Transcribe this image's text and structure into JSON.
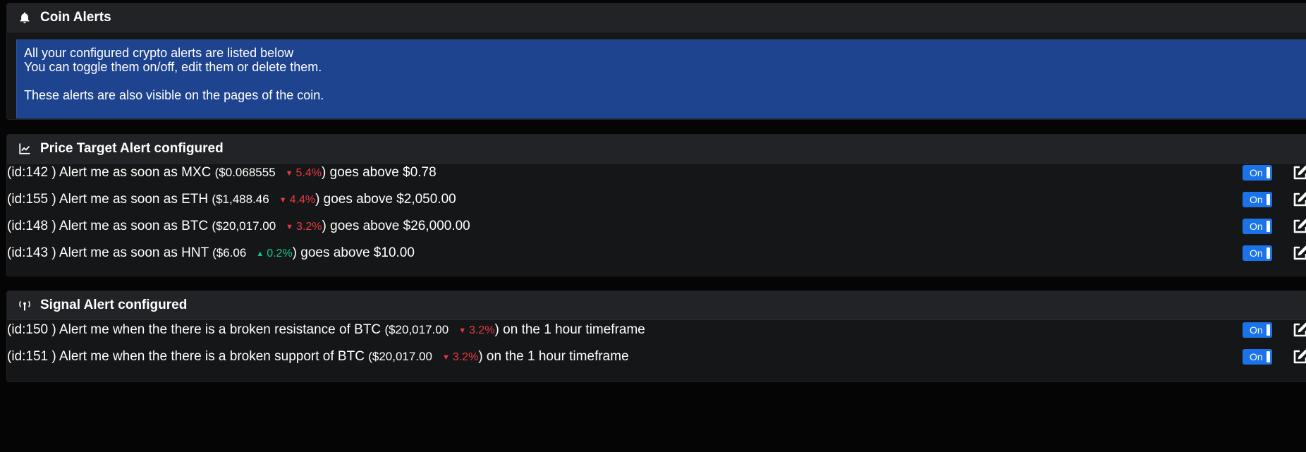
{
  "coin_alerts": {
    "title": "Coin Alerts",
    "icon": "bell-icon",
    "info_lines": [
      "All your configured crypto alerts are listed below",
      "You can toggle them on/off, edit them or delete them.",
      "These alerts are also visible on the pages of the coin."
    ]
  },
  "price_target": {
    "title": "Price Target Alert configured",
    "icon": "line-chart-icon",
    "rows": [
      {
        "prefix": "(id:142 ) Alert me as soon as MXC ",
        "price": "($0.068555",
        "pct": "5.4%",
        "direction": "down",
        "suffix": ") goes above $0.78",
        "toggle": "On"
      },
      {
        "prefix": "(id:155 ) Alert me as soon as ETH ",
        "price": "($1,488.46",
        "pct": "4.4%",
        "direction": "down",
        "suffix": ") goes above $2,050.00",
        "toggle": "On"
      },
      {
        "prefix": "(id:148 ) Alert me as soon as BTC ",
        "price": "($20,017.00",
        "pct": "3.2%",
        "direction": "down",
        "suffix": ") goes above $26,000.00",
        "toggle": "On"
      },
      {
        "prefix": "(id:143 ) Alert me as soon as HNT ",
        "price": "($6.06",
        "pct": "0.2%",
        "direction": "up",
        "suffix": ") goes above $10.00",
        "toggle": "On"
      }
    ]
  },
  "signal": {
    "title": "Signal Alert configured",
    "icon": "broadcast-icon",
    "rows": [
      {
        "prefix": "(id:150 ) Alert me when the there is a broken resistance of BTC ",
        "price": "($20,017.00",
        "pct": "3.2%",
        "direction": "down",
        "suffix": ") on the 1 hour timeframe",
        "toggle": "On"
      },
      {
        "prefix": "(id:151 ) Alert me when the there is a broken support of BTC ",
        "price": "($20,017.00",
        "pct": "3.2%",
        "direction": "down",
        "suffix": ") on the 1 hour timeframe",
        "toggle": "On"
      }
    ]
  },
  "colors": {
    "accent": "#1a73e8",
    "info_bg": "#1e438f",
    "down": "#ea3943",
    "up": "#16c784"
  }
}
